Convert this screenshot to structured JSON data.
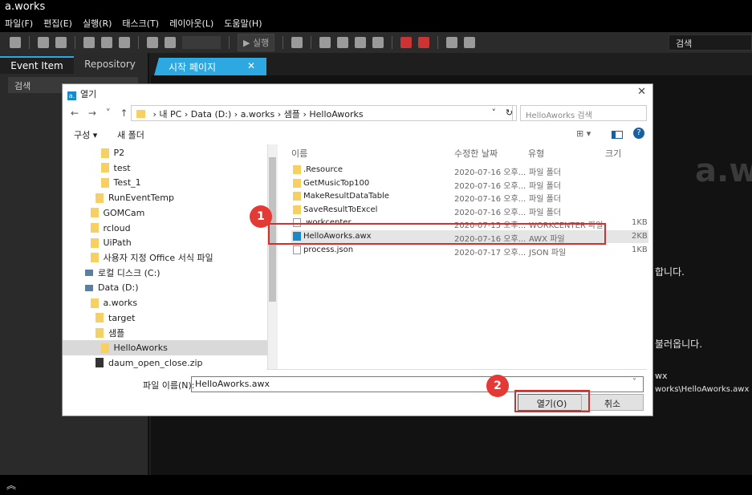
{
  "app": {
    "title": "a.works"
  },
  "menu": [
    "파일(F)",
    "편집(E)",
    "실행(R)",
    "태스크(T)",
    "레이아웃(L)",
    "도움말(H)"
  ],
  "toolbar": {
    "run_label": "실행",
    "search_label": "검색"
  },
  "left_panel": {
    "tabs": [
      "Event Item",
      "Repository"
    ],
    "search_label": "검색"
  },
  "main_tab": {
    "label": "시작 페이지",
    "close": "✕"
  },
  "background_text": {
    "logo": "a.w",
    "line1": "합니다.",
    "line2": "불러옵니다.",
    "line3": "wx",
    "line4": "works\\HelloAworks.awx"
  },
  "dialog": {
    "title_icon": "a.",
    "title": "열기",
    "close": "✕",
    "nav": "← → ˅ ↑",
    "address": [
      "내 PC",
      "Data (D:)",
      "a.works",
      "샘플",
      "HelloAworks"
    ],
    "address_sep": "›",
    "address_dropdown": "˅",
    "refresh": "↻",
    "search_placeholder": "HelloAworks 검색",
    "organize": "구성 ▾",
    "new_folder": "새 폴더",
    "view_icons": "⊞ ▾",
    "help": "?",
    "tree": [
      {
        "label": "P2",
        "indent": 3,
        "sel": false
      },
      {
        "label": "test",
        "indent": 3,
        "sel": false
      },
      {
        "label": "Test_1",
        "indent": 3,
        "sel": false
      },
      {
        "label": "RunEventTemp",
        "indent": 2,
        "sel": false
      },
      {
        "label": "GOMCam",
        "indent": 1,
        "sel": false
      },
      {
        "label": "rcloud",
        "indent": 1,
        "sel": false
      },
      {
        "label": "UiPath",
        "indent": 1,
        "sel": false
      },
      {
        "label": "사용자 지정 Office 서식 파일",
        "indent": 1,
        "sel": false
      },
      {
        "label": "로컬 디스크 (C:)",
        "indent": 0,
        "sel": false,
        "drive": true
      },
      {
        "label": "Data (D:)",
        "indent": 0,
        "sel": false,
        "drive": true
      },
      {
        "label": "a.works",
        "indent": 1,
        "sel": false
      },
      {
        "label": "target",
        "indent": 2,
        "sel": false
      },
      {
        "label": "샘플",
        "indent": 2,
        "sel": false
      },
      {
        "label": "HelloAworks",
        "indent": 3,
        "sel": true
      },
      {
        "label": "daum_open_close.zip",
        "indent": 2,
        "sel": false,
        "zip": true
      }
    ],
    "columns": [
      "이름",
      "수정한 날짜",
      "유형",
      "크기"
    ],
    "files": [
      {
        "name": ".Resource",
        "date": "2020-07-16 오후...",
        "type": "파일 폴더",
        "size": "",
        "kind": "folder"
      },
      {
        "name": "GetMusicTop100",
        "date": "2020-07-16 오후...",
        "type": "파일 폴더",
        "size": "",
        "kind": "folder"
      },
      {
        "name": "MakeResultDataTable",
        "date": "2020-07-16 오후...",
        "type": "파일 폴더",
        "size": "",
        "kind": "folder"
      },
      {
        "name": "SaveResultToExcel",
        "date": "2020-07-16 오후...",
        "type": "파일 폴더",
        "size": "",
        "kind": "folder"
      },
      {
        "name": ".workcenter",
        "date": "2020-07-15 오후...",
        "type": "WORKCENTER 파일",
        "size": "1KB",
        "kind": "doc"
      },
      {
        "name": "HelloAworks.awx",
        "date": "2020-07-16 오후...",
        "type": "AWX 파일",
        "size": "2KB",
        "kind": "awx"
      },
      {
        "name": "process.json",
        "date": "2020-07-17 오후...",
        "type": "JSON 파일",
        "size": "1KB",
        "kind": "doc"
      }
    ],
    "filename_label": "파일 이름(N):",
    "filename_value": "HelloAworks.awx",
    "open_label": "열기(O)",
    "cancel_label": "취소"
  },
  "annotations": {
    "badge1": "1",
    "badge2": "2"
  },
  "bottom": {
    "collapse": "︽"
  }
}
